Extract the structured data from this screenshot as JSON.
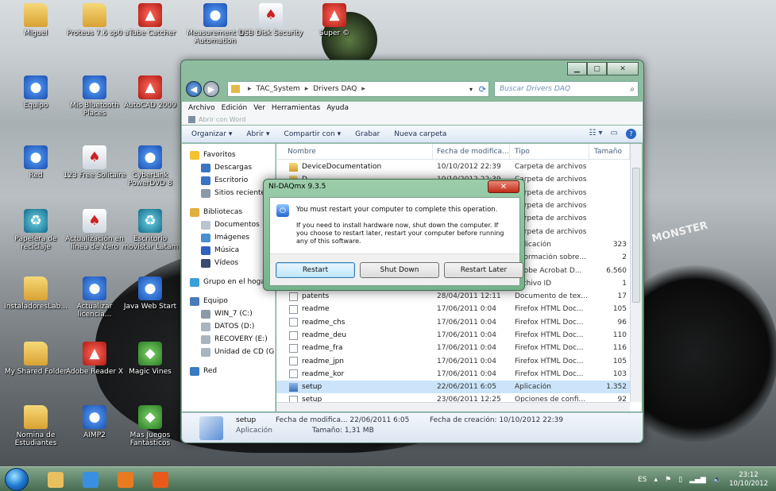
{
  "desktop": {
    "icons": [
      {
        "label": "Miguel",
        "kind": "folder"
      },
      {
        "label": "Proteus 7.6 sp0",
        "kind": "folder"
      },
      {
        "label": "aTube Catcher",
        "kind": "red"
      },
      {
        "label": "Measurement & Automation",
        "kind": "blue"
      },
      {
        "label": "USB Disk Security",
        "kind": "white"
      },
      {
        "label": "Super ©",
        "kind": "red"
      },
      {
        "label": "Equipo",
        "kind": "blue"
      },
      {
        "label": "Mis Bluetooth Places",
        "kind": "blue"
      },
      {
        "label": "AutoCAD 2009",
        "kind": "red"
      },
      {
        "label": "Red",
        "kind": "blue"
      },
      {
        "label": "123 Free Solitaire",
        "kind": "white"
      },
      {
        "label": "CyberLink PowerDVD 8",
        "kind": "blue"
      },
      {
        "label": "Papelera de reciclaje",
        "kind": "teal"
      },
      {
        "label": "Actualización en línea de Nero",
        "kind": "white"
      },
      {
        "label": "Escritorio movistar Latam",
        "kind": "teal"
      },
      {
        "label": "InstaladoresLab...",
        "kind": "folder"
      },
      {
        "label": "Actualizar licencia...",
        "kind": "blue"
      },
      {
        "label": "Java Web Start",
        "kind": "blue"
      },
      {
        "label": "My Shared Folder",
        "kind": "folder"
      },
      {
        "label": "Adobe Reader X",
        "kind": "red"
      },
      {
        "label": "Magic Vines",
        "kind": "green"
      },
      {
        "label": "Nomina de Estudiantes",
        "kind": "folder"
      },
      {
        "label": "AIMP2",
        "kind": "blue"
      },
      {
        "label": "Mas Juegos Fantásticos",
        "kind": "green"
      }
    ],
    "wallpaper_text": "MONSTER"
  },
  "explorer": {
    "breadcrumb": [
      "TAC_System",
      "Drivers DAQ"
    ],
    "search_placeholder": "Buscar Drivers DAQ",
    "menu": [
      "Archivo",
      "Edición",
      "Ver",
      "Herramientas",
      "Ayuda"
    ],
    "word_bar": "Abrir con Word",
    "toolbar": {
      "organize": "Organizar ▾",
      "open": "Abrir ▾",
      "share": "Compartir con ▾",
      "burn": "Grabar",
      "new_folder": "Nueva carpeta"
    },
    "nav": [
      {
        "label": "Favoritos",
        "header": true,
        "color": "#f2c230"
      },
      {
        "label": "Descargas",
        "header": false,
        "color": "#3a74c4"
      },
      {
        "label": "Escritorio",
        "header": false,
        "color": "#3a74c4"
      },
      {
        "label": "Sitios recientes",
        "header": false,
        "color": "#8a98a8"
      },
      {
        "label": "Bibliotecas",
        "header": true,
        "color": "#e0b040"
      },
      {
        "label": "Documentos",
        "header": false,
        "color": "#b8c4d0"
      },
      {
        "label": "Imágenes",
        "header": false,
        "color": "#4a90d0"
      },
      {
        "label": "Música",
        "header": false,
        "color": "#3060c0"
      },
      {
        "label": "Vídeos",
        "header": false,
        "color": "#3a4a70"
      },
      {
        "label": "Grupo en el hogar",
        "header": true,
        "color": "#3aa0d8"
      },
      {
        "label": "Equipo",
        "header": true,
        "color": "#4a7ab8"
      },
      {
        "label": "WIN_7 (C:)",
        "header": false,
        "color": "#8a9aa8"
      },
      {
        "label": "DATOS (D:)",
        "header": false,
        "color": "#a8b4c0"
      },
      {
        "label": "RECOVERY (E:)",
        "header": false,
        "color": "#a8b4c0"
      },
      {
        "label": "Unidad de CD (G:)",
        "header": false,
        "color": "#a8b4c0"
      },
      {
        "label": "Red",
        "header": true,
        "color": "#3a7ac0"
      }
    ],
    "columns": [
      "Nombre",
      "Fecha de modifica...",
      "Tipo",
      "Tamaño"
    ],
    "files": [
      {
        "name": "DeviceDocumentation",
        "date": "10/10/2012 22:39",
        "type": "Carpeta de archivos",
        "size": "",
        "icon": "folder"
      },
      {
        "name": "D",
        "date": "10/10/2012 22:39",
        "type": "Carpeta de archivos",
        "size": "",
        "icon": "folder"
      },
      {
        "name": "",
        "date": "",
        "type": "Carpeta de archivos",
        "size": "",
        "icon": "folder"
      },
      {
        "name": "",
        "date": "",
        "type": "Carpeta de archivos",
        "size": "",
        "icon": "folder"
      },
      {
        "name": "",
        "date": "",
        "type": "Carpeta de archivos",
        "size": "",
        "icon": "folder"
      },
      {
        "name": "",
        "date": "",
        "type": "Carpeta de archivos",
        "size": "",
        "icon": "folder"
      },
      {
        "name": "",
        "date": "",
        "type": "Aplicación",
        "size": "323",
        "icon": "doc"
      },
      {
        "name": "",
        "date": "",
        "type": "Información sobre...",
        "size": "2",
        "icon": "doc"
      },
      {
        "name": "",
        "date": "",
        "type": "Adobe Acrobat D...",
        "size": "6.560",
        "icon": "doc"
      },
      {
        "name": "",
        "date": "",
        "type": "Archivo ID",
        "size": "1",
        "icon": "doc"
      },
      {
        "name": "patents",
        "date": "28/04/2011 12:11",
        "type": "Documento de tex...",
        "size": "17",
        "icon": "doc"
      },
      {
        "name": "readme",
        "date": "17/06/2011 0:04",
        "type": "Firefox HTML Doc...",
        "size": "105",
        "icon": "doc"
      },
      {
        "name": "readme_chs",
        "date": "17/06/2011 0:04",
        "type": "Firefox HTML Doc...",
        "size": "96",
        "icon": "doc"
      },
      {
        "name": "readme_deu",
        "date": "17/06/2011 0:04",
        "type": "Firefox HTML Doc...",
        "size": "110",
        "icon": "doc"
      },
      {
        "name": "readme_fra",
        "date": "17/06/2011 0:04",
        "type": "Firefox HTML Doc...",
        "size": "116",
        "icon": "doc"
      },
      {
        "name": "readme_jpn",
        "date": "17/06/2011 0:04",
        "type": "Firefox HTML Doc...",
        "size": "105",
        "icon": "doc"
      },
      {
        "name": "readme_kor",
        "date": "17/06/2011 0:04",
        "type": "Firefox HTML Doc...",
        "size": "103",
        "icon": "doc"
      },
      {
        "name": "setup",
        "date": "22/06/2011 6:05",
        "type": "Aplicación",
        "size": "1.352",
        "icon": "setup",
        "selected": true
      },
      {
        "name": "setup",
        "date": "23/06/2011 12:25",
        "type": "Opciones de confi...",
        "size": "92",
        "icon": "doc"
      }
    ],
    "details": {
      "name": "setup",
      "kind": "Aplicación",
      "modified": "Fecha de modifica... 22/06/2011 6:05",
      "size": "Tamaño: 1,31 MB",
      "created": "Fecha de creación: 10/10/2012 22:39"
    }
  },
  "dialog": {
    "title": "NI-DAQmx 9.3.5",
    "close_label": "✕",
    "message": "You must restart your computer to complete this operation.",
    "detail": "If you need to install hardware now, shut down the computer. If you choose to restart later, restart your computer before running any of this software.",
    "buttons": {
      "restart": "Restart",
      "shutdown": "Shut Down",
      "later": "Restart Later"
    }
  },
  "taskbar": {
    "apps": [
      {
        "name": "explorer",
        "color": "#e8c060"
      },
      {
        "name": "internet-explorer",
        "color": "#3a90e0"
      },
      {
        "name": "media-player",
        "color": "#e87a20"
      },
      {
        "name": "firefox",
        "color": "#e85a1a"
      }
    ],
    "language": "ES",
    "time": "23:12",
    "date": "10/10/2012"
  }
}
